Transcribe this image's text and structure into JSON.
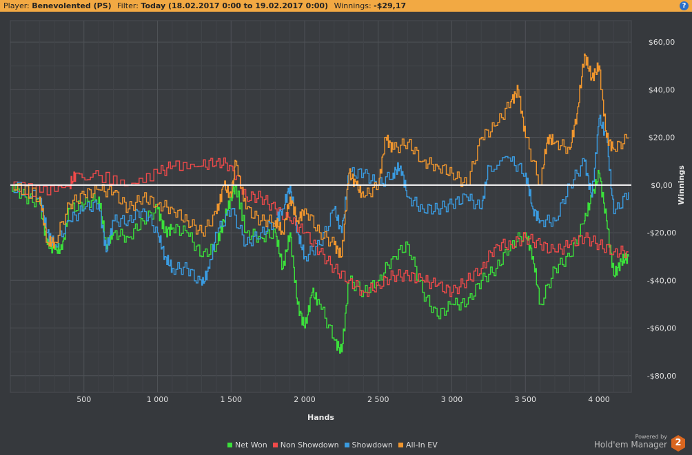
{
  "header": {
    "player_label": "Player:",
    "player": "Benevolented (PS)",
    "filter_label": "Filter:",
    "filter": "Today (18.02.2017 0:00 to 19.02.2017 0:00)",
    "winnings_label": "Winnings:",
    "winnings": "-$29,17",
    "help": "?"
  },
  "brand": {
    "powered_by": "Powered by",
    "name": "Hold'em Manager",
    "version": "2"
  },
  "chart_data": {
    "type": "line",
    "xlabel": "Hands",
    "ylabel": "Winnings",
    "xlim": [
      0,
      4220
    ],
    "ylim": [
      -87,
      69
    ],
    "x_ticks": [
      500,
      1000,
      1500,
      2000,
      2500,
      3000,
      3500,
      4000
    ],
    "x_tick_labels": [
      "500",
      "1 000",
      "1 500",
      "2 000",
      "2 500",
      "3 000",
      "3 500",
      "4 000"
    ],
    "y_ticks": [
      60,
      40,
      20,
      0,
      -20,
      -40,
      -60,
      -80
    ],
    "y_tick_labels": [
      "$60,00",
      "$40,00",
      "$20,00",
      "$0,00",
      "-$20,00",
      "-$40,00",
      "-$60,00",
      "-$80,00"
    ],
    "grid": true,
    "legend_position": "bottom",
    "series": [
      {
        "name": "Net Won",
        "color": "#3be03b",
        "points": [
          [
            0,
            0
          ],
          [
            100,
            -5
          ],
          [
            200,
            -8
          ],
          [
            250,
            -25
          ],
          [
            300,
            -27
          ],
          [
            350,
            -27
          ],
          [
            400,
            -10
          ],
          [
            500,
            -8
          ],
          [
            600,
            -5
          ],
          [
            650,
            -25
          ],
          [
            700,
            -20
          ],
          [
            800,
            -22
          ],
          [
            900,
            -15
          ],
          [
            1000,
            -10
          ],
          [
            1050,
            -20
          ],
          [
            1100,
            -18
          ],
          [
            1200,
            -20
          ],
          [
            1300,
            -30
          ],
          [
            1400,
            -25
          ],
          [
            1450,
            -15
          ],
          [
            1500,
            -5
          ],
          [
            1530,
            0
          ],
          [
            1600,
            -20
          ],
          [
            1700,
            -22
          ],
          [
            1800,
            -20
          ],
          [
            1850,
            -35
          ],
          [
            1900,
            -20
          ],
          [
            1950,
            -50
          ],
          [
            2000,
            -60
          ],
          [
            2050,
            -45
          ],
          [
            2100,
            -50
          ],
          [
            2200,
            -65
          ],
          [
            2250,
            -70
          ],
          [
            2300,
            -40
          ],
          [
            2400,
            -45
          ],
          [
            2500,
            -40
          ],
          [
            2600,
            -30
          ],
          [
            2700,
            -25
          ],
          [
            2800,
            -45
          ],
          [
            2900,
            -55
          ],
          [
            3000,
            -50
          ],
          [
            3100,
            -50
          ],
          [
            3200,
            -40
          ],
          [
            3300,
            -35
          ],
          [
            3400,
            -25
          ],
          [
            3500,
            -20
          ],
          [
            3550,
            -30
          ],
          [
            3600,
            -50
          ],
          [
            3700,
            -35
          ],
          [
            3800,
            -30
          ],
          [
            3900,
            -15
          ],
          [
            3950,
            -5
          ],
          [
            4000,
            5
          ],
          [
            4050,
            -15
          ],
          [
            4100,
            -38
          ],
          [
            4150,
            -32
          ],
          [
            4200,
            -30
          ]
        ]
      },
      {
        "name": "Non Showdown",
        "color": "#f04a4a",
        "points": [
          [
            0,
            0
          ],
          [
            200,
            -3
          ],
          [
            400,
            0
          ],
          [
            450,
            5
          ],
          [
            600,
            4
          ],
          [
            800,
            0
          ],
          [
            1000,
            5
          ],
          [
            1100,
            8
          ],
          [
            1300,
            8
          ],
          [
            1400,
            10
          ],
          [
            1500,
            8
          ],
          [
            1600,
            -5
          ],
          [
            1700,
            -5
          ],
          [
            1800,
            -10
          ],
          [
            1900,
            -15
          ],
          [
            2000,
            -20
          ],
          [
            2100,
            -28
          ],
          [
            2200,
            -35
          ],
          [
            2300,
            -40
          ],
          [
            2400,
            -45
          ],
          [
            2500,
            -42
          ],
          [
            2600,
            -38
          ],
          [
            2700,
            -38
          ],
          [
            2800,
            -40
          ],
          [
            2900,
            -42
          ],
          [
            3000,
            -45
          ],
          [
            3100,
            -40
          ],
          [
            3200,
            -35
          ],
          [
            3300,
            -25
          ],
          [
            3400,
            -25
          ],
          [
            3500,
            -22
          ],
          [
            3600,
            -25
          ],
          [
            3700,
            -28
          ],
          [
            3800,
            -25
          ],
          [
            3900,
            -22
          ],
          [
            4000,
            -25
          ],
          [
            4100,
            -28
          ],
          [
            4200,
            -28
          ]
        ]
      },
      {
        "name": "Showdown",
        "color": "#3a9be0",
        "points": [
          [
            0,
            0
          ],
          [
            200,
            -5
          ],
          [
            250,
            -20
          ],
          [
            300,
            -25
          ],
          [
            400,
            -15
          ],
          [
            500,
            -10
          ],
          [
            600,
            -8
          ],
          [
            650,
            -28
          ],
          [
            700,
            -15
          ],
          [
            800,
            -15
          ],
          [
            900,
            -10
          ],
          [
            1000,
            -20
          ],
          [
            1050,
            -30
          ],
          [
            1100,
            -35
          ],
          [
            1200,
            -35
          ],
          [
            1300,
            -42
          ],
          [
            1350,
            -35
          ],
          [
            1400,
            -20
          ],
          [
            1500,
            -10
          ],
          [
            1600,
            -25
          ],
          [
            1700,
            -20
          ],
          [
            1800,
            -15
          ],
          [
            1850,
            -10
          ],
          [
            1900,
            0
          ],
          [
            1950,
            -20
          ],
          [
            2000,
            -30
          ],
          [
            2100,
            -25
          ],
          [
            2200,
            -10
          ],
          [
            2250,
            -20
          ],
          [
            2300,
            5
          ],
          [
            2400,
            5
          ],
          [
            2500,
            0
          ],
          [
            2600,
            5
          ],
          [
            2650,
            8
          ],
          [
            2700,
            -5
          ],
          [
            2800,
            -10
          ],
          [
            2900,
            -10
          ],
          [
            3000,
            -8
          ],
          [
            3100,
            -5
          ],
          [
            3200,
            -10
          ],
          [
            3250,
            8
          ],
          [
            3400,
            10
          ],
          [
            3500,
            5
          ],
          [
            3550,
            -10
          ],
          [
            3600,
            -15
          ],
          [
            3700,
            -15
          ],
          [
            3800,
            0
          ],
          [
            3900,
            10
          ],
          [
            3950,
            -5
          ],
          [
            4000,
            28
          ],
          [
            4050,
            20
          ],
          [
            4100,
            -12
          ],
          [
            4200,
            -3
          ]
        ]
      },
      {
        "name": "All-In EV",
        "color": "#f0962e",
        "points": [
          [
            0,
            0
          ],
          [
            200,
            -5
          ],
          [
            250,
            -24
          ],
          [
            300,
            -24
          ],
          [
            400,
            -8
          ],
          [
            500,
            -4
          ],
          [
            600,
            -2
          ],
          [
            700,
            -3
          ],
          [
            800,
            -10
          ],
          [
            900,
            -5
          ],
          [
            1000,
            -8
          ],
          [
            1100,
            -10
          ],
          [
            1200,
            -15
          ],
          [
            1300,
            -20
          ],
          [
            1400,
            -12
          ],
          [
            1450,
            0
          ],
          [
            1500,
            -5
          ],
          [
            1530,
            10
          ],
          [
            1600,
            -10
          ],
          [
            1700,
            -15
          ],
          [
            1800,
            -15
          ],
          [
            1850,
            -20
          ],
          [
            1900,
            -5
          ],
          [
            1950,
            -15
          ],
          [
            2000,
            -10
          ],
          [
            2100,
            -20
          ],
          [
            2200,
            -25
          ],
          [
            2250,
            -30
          ],
          [
            2300,
            5
          ],
          [
            2350,
            0
          ],
          [
            2400,
            -5
          ],
          [
            2500,
            0
          ],
          [
            2550,
            20
          ],
          [
            2600,
            15
          ],
          [
            2700,
            18
          ],
          [
            2800,
            10
          ],
          [
            2900,
            8
          ],
          [
            3000,
            5
          ],
          [
            3100,
            0
          ],
          [
            3200,
            20
          ],
          [
            3300,
            25
          ],
          [
            3400,
            35
          ],
          [
            3450,
            40
          ],
          [
            3500,
            20
          ],
          [
            3600,
            0
          ],
          [
            3650,
            20
          ],
          [
            3700,
            18
          ],
          [
            3800,
            15
          ],
          [
            3850,
            30
          ],
          [
            3900,
            55
          ],
          [
            3950,
            45
          ],
          [
            4000,
            50
          ],
          [
            4050,
            20
          ],
          [
            4100,
            15
          ],
          [
            4200,
            20
          ]
        ]
      }
    ]
  }
}
